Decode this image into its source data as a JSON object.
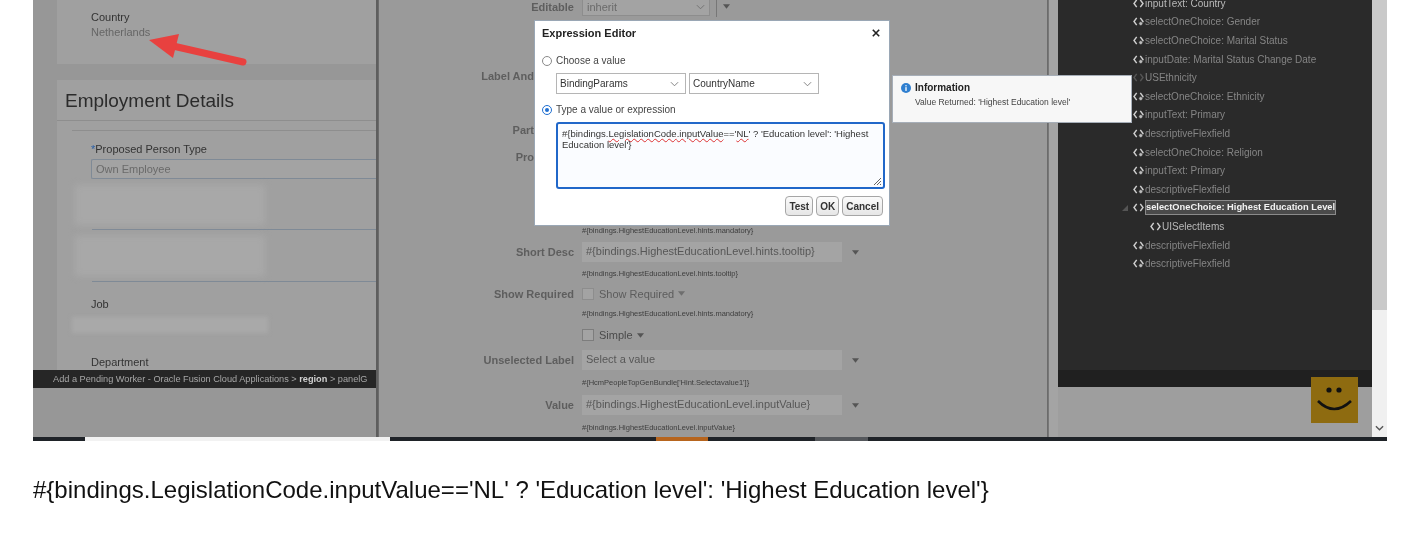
{
  "left_panel": {
    "country": {
      "label": "Country",
      "value": "Netherlands"
    },
    "section_title": "Employment Details",
    "fields": [
      {
        "kind": "input",
        "label": "Proposed Person Type",
        "required_mark": "*",
        "value": "Own Employee"
      },
      {
        "kind": "blurred"
      },
      {
        "kind": "blurred"
      },
      {
        "kind": "label",
        "label": "Job"
      },
      {
        "kind": "blurred_bar"
      },
      {
        "kind": "label",
        "label": "Department"
      }
    ],
    "breadcrumb": "Add a Pending Worker - Oracle Fusion Cloud Applications > **region** > panelG"
  },
  "properties": [
    {
      "kind": "select",
      "label": "Editable",
      "value": "inherit"
    },
    {
      "kind": "label_only",
      "label": "Label And"
    },
    {
      "kind": "label_only",
      "label": "Part"
    },
    {
      "kind": "label_only",
      "label": "Pro"
    },
    {
      "kind": "hint",
      "text": "#{bindings.HighestEducationLevel.hints.mandatory}"
    },
    {
      "kind": "field",
      "label": "Short Desc",
      "placeholder": "#{bindings.HighestEducationLevel.hints.tooltip}"
    },
    {
      "kind": "hint",
      "text": "#{bindings.HighestEducationLevel.hints.tooltip}"
    },
    {
      "kind": "checkbox",
      "label": "Show Required",
      "text": "Show Required",
      "checked": false,
      "disabled": true
    },
    {
      "kind": "hint",
      "text": "#{bindings.HighestEducationLevel.hints.mandatory}"
    },
    {
      "kind": "checkbox",
      "text": "Simple",
      "checked": false,
      "disabled": false
    },
    {
      "kind": "field",
      "label": "Unselected Label",
      "placeholder": "Select a value"
    },
    {
      "kind": "hint",
      "text": "#{HcmPeopleTopGenBundle['Hint.Selectavalue1']}"
    },
    {
      "kind": "field",
      "label": "Value",
      "placeholder": "#{bindings.HighestEducationLevel.inputValue}"
    },
    {
      "kind": "hint",
      "text": "#{bindings.HighestEducationLevel.inputValue}"
    }
  ],
  "tree": [
    {
      "label": "inputText: Country",
      "kind": "plain",
      "selected": false
    },
    {
      "label": "selectOneChoice: Gender",
      "kind": "badged",
      "selected": false
    },
    {
      "label": "selectOneChoice: Marital Status",
      "kind": "badged",
      "selected": false
    },
    {
      "label": "inputDate: Marital Status Change Date",
      "kind": "badged",
      "selected": false
    },
    {
      "label": "USEthnicity",
      "kind": "faded",
      "selected": false
    },
    {
      "label": "selectOneChoice: Ethnicity",
      "kind": "badged",
      "selected": false
    },
    {
      "label": "inputText: Primary",
      "kind": "badged",
      "selected": false
    },
    {
      "label": "descriptiveFlexfield",
      "kind": "badged",
      "selected": false
    },
    {
      "label": "selectOneChoice: Religion",
      "kind": "badged",
      "selected": false
    },
    {
      "label": "inputText: Primary",
      "kind": "badged",
      "selected": false
    },
    {
      "label": "descriptiveFlexfield",
      "kind": "badged",
      "selected": false
    },
    {
      "label": "selectOneChoice: Highest Education Level",
      "kind": "plain",
      "selected": true,
      "expanded": true,
      "children": [
        {
          "label": "UISelectItems",
          "kind": "plain",
          "selected": false
        }
      ]
    },
    {
      "label": "descriptiveFlexfield",
      "kind": "badged",
      "selected": false
    },
    {
      "label": "descriptiveFlexfield",
      "kind": "badged",
      "selected": false
    }
  ],
  "dialog": {
    "title": "Expression Editor",
    "options": [
      {
        "kind": "choose",
        "label": "Choose a value",
        "selected": false,
        "selects": [
          "BindingParams",
          "CountryName"
        ]
      },
      {
        "kind": "expression",
        "label": "Type a value or expression",
        "selected": true,
        "expression": [
          {
            "text": "#{bindings.",
            "misspelled": false
          },
          {
            "text": "LegislationCode",
            "misspelled": true
          },
          {
            "text": ".inputValue",
            "misspelled": true
          },
          {
            "text": "=='",
            "misspelled": false
          },
          {
            "text": "NL",
            "misspelled": true
          },
          {
            "text": "' ? 'Education level': 'Highest Education level'}",
            "misspelled": false
          }
        ]
      }
    ],
    "buttons": [
      "Test",
      "OK",
      "Cancel"
    ]
  },
  "info_popover": {
    "title": "Information",
    "message": "Value Returned: 'Highest Education level'"
  },
  "document_text": "#{bindings.LegislationCode.inputValue=='NL' ? 'Education level': 'Highest Education level'}"
}
